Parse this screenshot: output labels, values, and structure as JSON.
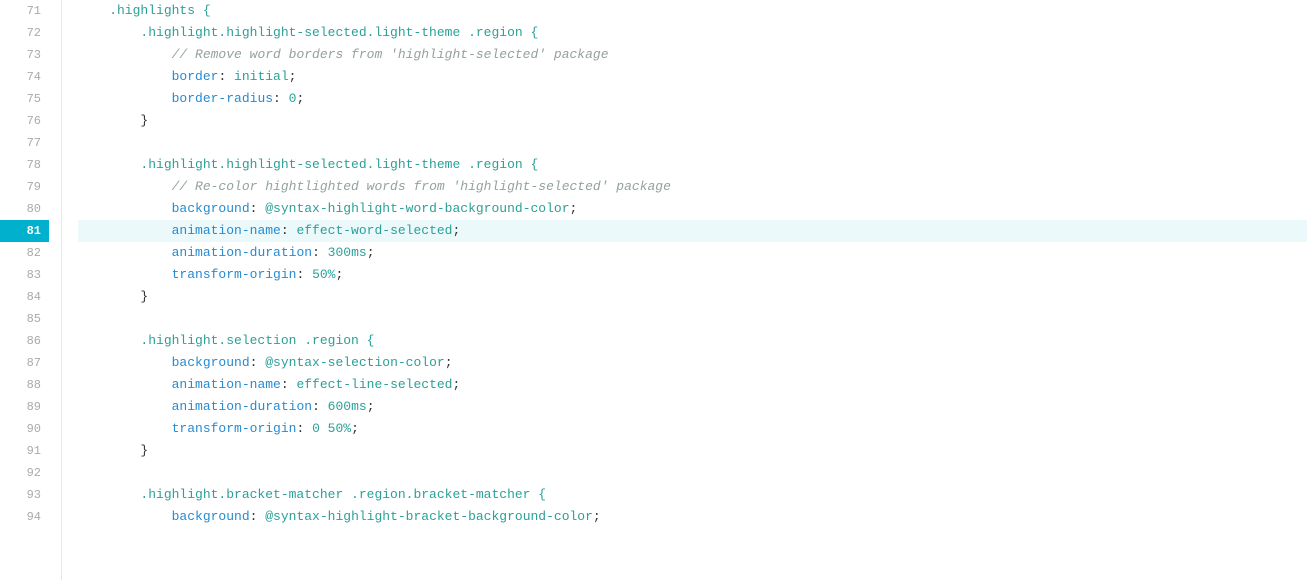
{
  "editor": {
    "title": "highlights",
    "lines": [
      {
        "num": 71,
        "active": false,
        "tokens": [
          {
            "text": "    .highlights {",
            "class": "selector"
          }
        ]
      },
      {
        "num": 72,
        "active": false,
        "tokens": [
          {
            "text": "        .highlight.highlight-selected.light-theme .region {",
            "class": "selector"
          }
        ]
      },
      {
        "num": 73,
        "active": false,
        "tokens": [
          {
            "text": "            ",
            "class": "plain"
          },
          {
            "text": "// Remove word borders from 'highlight-selected' package",
            "class": "comment"
          }
        ]
      },
      {
        "num": 74,
        "active": false,
        "tokens": [
          {
            "text": "            ",
            "class": "plain"
          },
          {
            "text": "border",
            "class": "property"
          },
          {
            "text": ": ",
            "class": "plain"
          },
          {
            "text": "initial",
            "class": "keyword-value"
          },
          {
            "text": ";",
            "class": "plain"
          }
        ]
      },
      {
        "num": 75,
        "active": false,
        "tokens": [
          {
            "text": "            ",
            "class": "plain"
          },
          {
            "text": "border-radius",
            "class": "property"
          },
          {
            "text": ": ",
            "class": "plain"
          },
          {
            "text": "0",
            "class": "number-value"
          },
          {
            "text": ";",
            "class": "plain"
          }
        ]
      },
      {
        "num": 76,
        "active": false,
        "tokens": [
          {
            "text": "        }",
            "class": "plain"
          }
        ]
      },
      {
        "num": 77,
        "active": false,
        "tokens": [
          {
            "text": "",
            "class": "plain"
          }
        ]
      },
      {
        "num": 78,
        "active": false,
        "tokens": [
          {
            "text": "        .highlight.highlight-selected.light-theme .region {",
            "class": "selector"
          }
        ]
      },
      {
        "num": 79,
        "active": false,
        "tokens": [
          {
            "text": "            ",
            "class": "plain"
          },
          {
            "text": "// Re-color hightlighted words from 'highlight-selected' package",
            "class": "comment"
          }
        ]
      },
      {
        "num": 80,
        "active": false,
        "tokens": [
          {
            "text": "            ",
            "class": "plain"
          },
          {
            "text": "background",
            "class": "property"
          },
          {
            "text": ": ",
            "class": "plain"
          },
          {
            "text": "@syntax-highlight-word-background-color",
            "class": "at-variable"
          },
          {
            "text": ";",
            "class": "plain"
          }
        ]
      },
      {
        "num": 81,
        "active": true,
        "tokens": [
          {
            "text": "            ",
            "class": "plain"
          },
          {
            "text": "animation-name",
            "class": "property"
          },
          {
            "text": ": ",
            "class": "plain"
          },
          {
            "text": "effect-word-selected",
            "class": "value"
          },
          {
            "text": ";",
            "class": "plain"
          }
        ]
      },
      {
        "num": 82,
        "active": false,
        "tokens": [
          {
            "text": "            ",
            "class": "plain"
          },
          {
            "text": "animation-duration",
            "class": "property"
          },
          {
            "text": ": ",
            "class": "plain"
          },
          {
            "text": "300ms",
            "class": "value"
          },
          {
            "text": ";",
            "class": "plain"
          }
        ]
      },
      {
        "num": 83,
        "active": false,
        "tokens": [
          {
            "text": "            ",
            "class": "plain"
          },
          {
            "text": "transform-origin",
            "class": "property"
          },
          {
            "text": ": ",
            "class": "plain"
          },
          {
            "text": "50%",
            "class": "value"
          },
          {
            "text": ";",
            "class": "plain"
          }
        ]
      },
      {
        "num": 84,
        "active": false,
        "tokens": [
          {
            "text": "        }",
            "class": "plain"
          }
        ]
      },
      {
        "num": 85,
        "active": false,
        "tokens": [
          {
            "text": "",
            "class": "plain"
          }
        ]
      },
      {
        "num": 86,
        "active": false,
        "tokens": [
          {
            "text": "        .highlight.selection .region {",
            "class": "selector"
          }
        ]
      },
      {
        "num": 87,
        "active": false,
        "tokens": [
          {
            "text": "            ",
            "class": "plain"
          },
          {
            "text": "background",
            "class": "property"
          },
          {
            "text": ": ",
            "class": "plain"
          },
          {
            "text": "@syntax-selection-color",
            "class": "at-variable"
          },
          {
            "text": ";",
            "class": "plain"
          }
        ]
      },
      {
        "num": 88,
        "active": false,
        "tokens": [
          {
            "text": "            ",
            "class": "plain"
          },
          {
            "text": "animation-name",
            "class": "property"
          },
          {
            "text": ": ",
            "class": "plain"
          },
          {
            "text": "effect-line-selected",
            "class": "value"
          },
          {
            "text": ";",
            "class": "plain"
          }
        ]
      },
      {
        "num": 89,
        "active": false,
        "tokens": [
          {
            "text": "            ",
            "class": "plain"
          },
          {
            "text": "animation-duration",
            "class": "property"
          },
          {
            "text": ": ",
            "class": "plain"
          },
          {
            "text": "600ms",
            "class": "value"
          },
          {
            "text": ";",
            "class": "plain"
          }
        ]
      },
      {
        "num": 90,
        "active": false,
        "tokens": [
          {
            "text": "            ",
            "class": "plain"
          },
          {
            "text": "transform-origin",
            "class": "property"
          },
          {
            "text": ": ",
            "class": "plain"
          },
          {
            "text": "0 50%",
            "class": "value"
          },
          {
            "text": ";",
            "class": "plain"
          }
        ]
      },
      {
        "num": 91,
        "active": false,
        "tokens": [
          {
            "text": "        }",
            "class": "plain"
          }
        ]
      },
      {
        "num": 92,
        "active": false,
        "tokens": [
          {
            "text": "",
            "class": "plain"
          }
        ]
      },
      {
        "num": 93,
        "active": false,
        "tokens": [
          {
            "text": "        .highlight.bracket-matcher .region.bracket-matcher {",
            "class": "selector"
          }
        ]
      },
      {
        "num": 94,
        "active": false,
        "tokens": [
          {
            "text": "            ",
            "class": "plain"
          },
          {
            "text": "background",
            "class": "property"
          },
          {
            "text": ": ",
            "class": "plain"
          },
          {
            "text": "@syntax-highlight-bracket-background-color",
            "class": "at-variable"
          },
          {
            "text": ";",
            "class": "plain"
          }
        ]
      }
    ]
  }
}
